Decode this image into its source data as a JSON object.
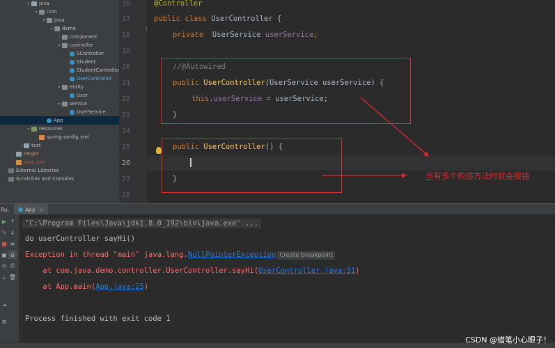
{
  "project_tree": {
    "items": [
      {
        "label": "java",
        "indent": 3,
        "icon": "folder",
        "arrow": "▾"
      },
      {
        "label": "com",
        "indent": 4,
        "icon": "pkg",
        "arrow": "▾"
      },
      {
        "label": "java",
        "indent": 5,
        "icon": "pkg",
        "arrow": "▾"
      },
      {
        "label": "demo",
        "indent": 6,
        "icon": "pkg",
        "arrow": "▾"
      },
      {
        "label": "component",
        "indent": 7,
        "icon": "pkg",
        "arrow": "›"
      },
      {
        "label": "controller",
        "indent": 7,
        "icon": "pkg",
        "arrow": "▾"
      },
      {
        "label": "SController",
        "indent": 8,
        "icon": "cls",
        "arrow": ""
      },
      {
        "label": "Student",
        "indent": 8,
        "icon": "cls",
        "arrow": ""
      },
      {
        "label": "StudentController",
        "indent": 8,
        "icon": "cls",
        "arrow": ""
      },
      {
        "label": "UserController",
        "indent": 8,
        "icon": "cls",
        "arrow": "",
        "color": "blue"
      },
      {
        "label": "entity",
        "indent": 7,
        "icon": "pkg",
        "arrow": "▾"
      },
      {
        "label": "User",
        "indent": 8,
        "icon": "cls",
        "arrow": ""
      },
      {
        "label": "service",
        "indent": 7,
        "icon": "pkg",
        "arrow": "▾"
      },
      {
        "label": "UserService",
        "indent": 8,
        "icon": "cls",
        "arrow": ""
      },
      {
        "label": "App",
        "indent": 5,
        "icon": "cls",
        "arrow": "",
        "selected": true
      },
      {
        "label": "resources",
        "indent": 3,
        "icon": "res",
        "arrow": "▾"
      },
      {
        "label": "spring-config.xml",
        "indent": 4,
        "icon": "xml",
        "arrow": ""
      },
      {
        "label": "test",
        "indent": 2,
        "icon": "folder",
        "arrow": "›"
      },
      {
        "label": "target",
        "indent": 1,
        "icon": "folder",
        "arrow": "›",
        "color": "orange"
      },
      {
        "label": "pom.xml",
        "indent": 1,
        "icon": "xml",
        "arrow": "",
        "color": "red"
      },
      {
        "label": "External Libraries",
        "indent": 0,
        "icon": "lib",
        "arrow": ""
      },
      {
        "label": "Scratches and Consoles",
        "indent": 0,
        "icon": "lib",
        "arrow": ""
      }
    ]
  },
  "editor": {
    "line_numbers": [
      "16",
      "17",
      "18",
      "19",
      "20",
      "21",
      "22",
      "23",
      "24",
      "25",
      "26",
      "27",
      "28"
    ],
    "lines": {
      "l16": "@Controller",
      "l17_kw": "public class ",
      "l17_name": "UserController",
      "l17_rest": " {",
      "l18_kw": "private  ",
      "l18_type": "UserService ",
      "l18_field": "userService",
      "l18_end": ";",
      "l20": "//@Autowired",
      "l21_kw": "public ",
      "l21_name": "UserController",
      "l21_rest": "(UserService userService) {",
      "l22_this": "this",
      "l22_dot": ".",
      "l22_field": "userService",
      "l22_rest": " = userService;",
      "l23": "}",
      "l25_kw": "public ",
      "l25_name": "UserController",
      "l25_rest": "() {",
      "l27": "}"
    },
    "annotation_note": "当有多个构造方法时就会报错"
  },
  "run_panel": {
    "left_tab": "Ru:",
    "tab_label": "App",
    "tab_close": "×",
    "console": {
      "cmd": "\"C:\\Program Files\\Java\\jdk1.8.0_192\\bin\\java.exe\" ...",
      "out1": "do userController sayHi()",
      "err_prefix": "Exception in thread \"main\" java.lang.",
      "err_link": "NullPointerException",
      "err_tip": "Create breakpoint",
      "trace1_prefix": "    at com.java.demo.controller.UserController.sayHi(",
      "trace1_link": "UserController.java:31",
      "trace1_suffix": ")",
      "trace2_prefix": "    at App.main(",
      "trace2_link": "App.java:25",
      "trace2_suffix": ")",
      "exit": "Process finished with exit code 1"
    }
  },
  "watermark": "CSDN @蜡笔小心眼子！",
  "colors": {
    "highlight_red": "#e0272c",
    "keyword": "#cc7832",
    "method": "#ffc66d",
    "field": "#9876aa",
    "annotation": "#bbb529",
    "link": "#287bde",
    "error": "#ff6b68"
  }
}
